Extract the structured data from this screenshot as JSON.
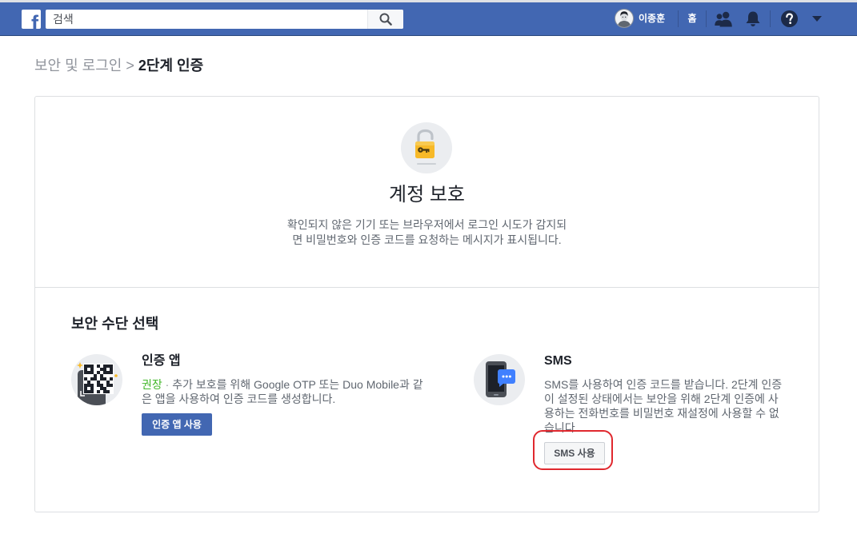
{
  "colors": {
    "header_bar": "#4267b2",
    "primary_button": "#4267b2",
    "recommended": "#42b72a",
    "annotation": "#e0282e"
  },
  "header": {
    "logo": {
      "glyph": "f",
      "icon": "facebook-logo-icon"
    },
    "search": {
      "placeholder": "검색",
      "icon": "search-icon"
    },
    "user": {
      "name": "이종훈",
      "icon": "profile-avatar-icon"
    },
    "home_label": "홈",
    "icons": [
      "friend-requests-icon",
      "notifications-bell-icon",
      "help-icon",
      "account-menu-caret-icon"
    ]
  },
  "breadcrumb": {
    "parent": "보안 및 로그인",
    "separator": ">",
    "current": "2단계 인증"
  },
  "hero": {
    "icon": "unlocked-padlock-icon",
    "title": "계정 보호",
    "description": "확인되지 않은 기기 또는 브라우저에서 로그인 시도가 감지되면 비밀번호와 인증 코드를 요청하는 메시지가 표시됩니다."
  },
  "methods": {
    "heading": "보안 수단 선택",
    "items": [
      {
        "icon": "qr-code-phone-icon",
        "title": "인증 앱",
        "badge": "권장",
        "separator": "·",
        "description": "추가 보호를 위해 Google OTP 또는 Duo Mobile과 같은 앱을 사용하여 인증 코드를 생성합니다.",
        "button_label": "인증 앱 사용"
      },
      {
        "icon": "sms-phone-icon",
        "title": "SMS",
        "description": "SMS를 사용하여 인증 코드를 받습니다. 2단계 인증이 설정된 상태에서는 보안을 위해 2단계 인증에 사용하는 전화번호를 비밀번호 재설정에 사용할 수 없습니다.",
        "button_label": "SMS 사용"
      }
    ]
  }
}
